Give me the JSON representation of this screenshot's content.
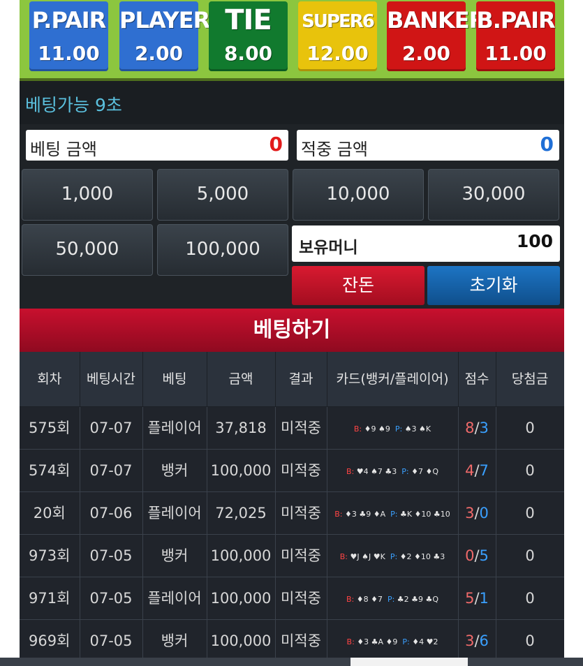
{
  "bets": [
    {
      "name": "P.PAIR",
      "odds": "11.00",
      "color": "#2f6fd1"
    },
    {
      "name": "PLAYER",
      "odds": "2.00",
      "color": "#2f6fd1"
    },
    {
      "name": "TIE",
      "odds": "8.00",
      "color": "#117a2e"
    },
    {
      "name": "SUPER6",
      "odds": "12.00",
      "color": "#e8c30c"
    },
    {
      "name": "BANKER",
      "odds": "2.00",
      "color": "#d01515"
    },
    {
      "name": "B.PAIR",
      "odds": "11.00",
      "color": "#d01515"
    }
  ],
  "timer_text": "베팅가능 9초",
  "bet_amount": {
    "label": "베팅 금액",
    "value": "0"
  },
  "win_amount": {
    "label": "적중 금액",
    "value": "0"
  },
  "chips": [
    "1,000",
    "5,000",
    "10,000",
    "30,000",
    "50,000",
    "100,000"
  ],
  "holding": {
    "label": "보유머니",
    "value": "100"
  },
  "buttons": {
    "change": "잔돈",
    "reset": "초기화",
    "place": "베팅하기"
  },
  "colors": {
    "red_btn": "#c8102e",
    "blue_btn": "#1560a8",
    "accent_green": "#8cc63f"
  },
  "table": {
    "headers": [
      "회차",
      "베팅시간",
      "베팅",
      "금액",
      "결과",
      "카드(뱅커/플레이어)",
      "점수",
      "당첨금"
    ],
    "rows": [
      {
        "round": "575회",
        "time": "07-07",
        "bet": "플레이어",
        "amount": "37,818",
        "result": "미적중",
        "b_label": "B:",
        "b_cards": "♦9 ♠9",
        "p_label": "P:",
        "p_cards": "♠3 ♠K",
        "score_b": "8",
        "score_p": "3",
        "prize": "0"
      },
      {
        "round": "574회",
        "time": "07-07",
        "bet": "뱅커",
        "amount": "100,000",
        "result": "미적중",
        "b_label": "B:",
        "b_cards": "♥4 ♠7 ♣3",
        "p_label": "P:",
        "p_cards": "♦7 ♦Q",
        "score_b": "4",
        "score_p": "7",
        "prize": "0"
      },
      {
        "round": "20회",
        "time": "07-06",
        "bet": "플레이어",
        "amount": "72,025",
        "result": "미적중",
        "b_label": "B:",
        "b_cards": "♦3 ♣9 ♦A",
        "p_label": "P:",
        "p_cards": "♣K ♦10 ♣10",
        "score_b": "3",
        "score_p": "0",
        "prize": "0"
      },
      {
        "round": "973회",
        "time": "07-05",
        "bet": "뱅커",
        "amount": "100,000",
        "result": "미적중",
        "b_label": "B:",
        "b_cards": "♥J ♠J ♥K",
        "p_label": "P:",
        "p_cards": "♦2 ♦10 ♣3",
        "score_b": "0",
        "score_p": "5",
        "prize": "0"
      },
      {
        "round": "971회",
        "time": "07-05",
        "bet": "플레이어",
        "amount": "100,000",
        "result": "미적중",
        "b_label": "B:",
        "b_cards": "♦8 ♦7",
        "p_label": "P:",
        "p_cards": "♣2 ♣9 ♣Q",
        "score_b": "5",
        "score_p": "1",
        "prize": "0"
      },
      {
        "round": "969회",
        "time": "07-05",
        "bet": "뱅커",
        "amount": "100,000",
        "result": "미적중",
        "b_label": "B:",
        "b_cards": "♦3 ♣A ♦9",
        "p_label": "P:",
        "p_cards": "♦4 ♥2",
        "score_b": "3",
        "score_p": "6",
        "prize": "0"
      }
    ]
  }
}
